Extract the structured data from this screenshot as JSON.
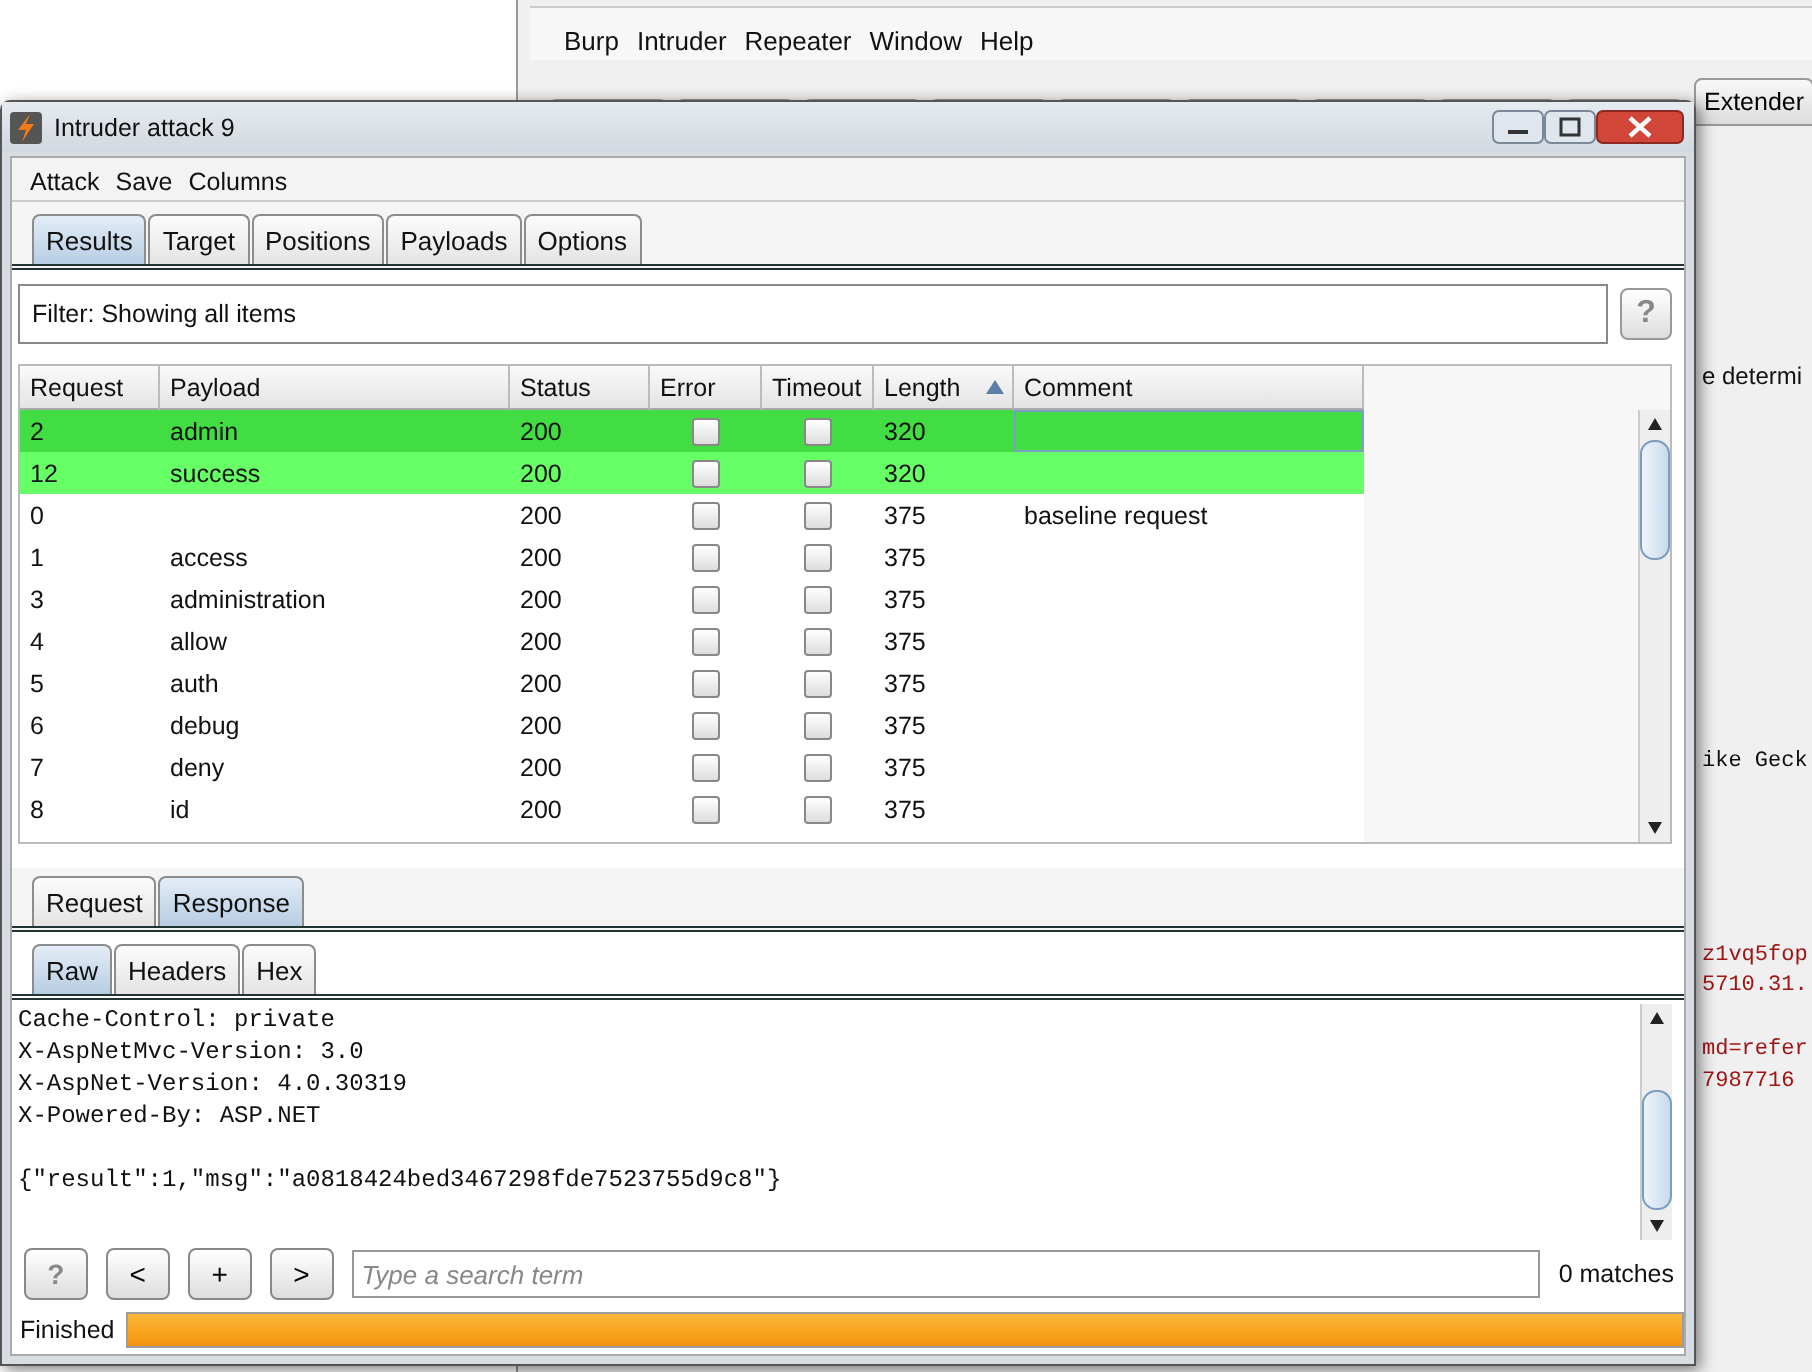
{
  "main_window": {
    "menu": [
      "Burp",
      "Intruder",
      "Repeater",
      "Window",
      "Help"
    ],
    "tabs": [
      {
        "label": "Extender",
        "selected": false
      }
    ],
    "fragments": [
      {
        "text": "e determi",
        "kind": "sans"
      },
      {
        "text": "ike Geck",
        "kind": "mono"
      },
      {
        "text": "z1vq5fop",
        "kind": "red"
      },
      {
        "text": "5710.31.",
        "kind": "red"
      },
      {
        "text": "md=refer",
        "kind": "red"
      },
      {
        "text": "7987716",
        "kind": "red"
      }
    ]
  },
  "window": {
    "title": "Intruder attack 9"
  },
  "menu": [
    "Attack",
    "Save",
    "Columns"
  ],
  "tabs": [
    {
      "label": "Results",
      "selected": true
    },
    {
      "label": "Target",
      "selected": false
    },
    {
      "label": "Positions",
      "selected": false
    },
    {
      "label": "Payloads",
      "selected": false
    },
    {
      "label": "Options",
      "selected": false
    }
  ],
  "filter": "Filter: Showing all items",
  "help_button": "?",
  "table": {
    "columns": [
      {
        "label": "Request",
        "sorted": false
      },
      {
        "label": "Payload",
        "sorted": false
      },
      {
        "label": "Status",
        "sorted": false
      },
      {
        "label": "Error",
        "sorted": false
      },
      {
        "label": "Timeout",
        "sorted": false
      },
      {
        "label": "Length",
        "sorted": true
      },
      {
        "label": "Comment",
        "sorted": false
      }
    ],
    "rows": [
      {
        "request": "2",
        "payload": "admin",
        "status": "200",
        "error": false,
        "timeout": false,
        "length": "320",
        "comment": "",
        "selected": true,
        "color": "#42dd42"
      },
      {
        "request": "12",
        "payload": "success",
        "status": "200",
        "error": false,
        "timeout": false,
        "length": "320",
        "comment": "",
        "selected": false,
        "color": "#66ff66"
      },
      {
        "request": "0",
        "payload": "",
        "status": "200",
        "error": false,
        "timeout": false,
        "length": "375",
        "comment": "baseline request",
        "selected": false
      },
      {
        "request": "1",
        "payload": "access",
        "status": "200",
        "error": false,
        "timeout": false,
        "length": "375",
        "comment": "",
        "selected": false
      },
      {
        "request": "3",
        "payload": "administration",
        "status": "200",
        "error": false,
        "timeout": false,
        "length": "375",
        "comment": "",
        "selected": false
      },
      {
        "request": "4",
        "payload": "allow",
        "status": "200",
        "error": false,
        "timeout": false,
        "length": "375",
        "comment": "",
        "selected": false
      },
      {
        "request": "5",
        "payload": "auth",
        "status": "200",
        "error": false,
        "timeout": false,
        "length": "375",
        "comment": "",
        "selected": false
      },
      {
        "request": "6",
        "payload": "debug",
        "status": "200",
        "error": false,
        "timeout": false,
        "length": "375",
        "comment": "",
        "selected": false
      },
      {
        "request": "7",
        "payload": "deny",
        "status": "200",
        "error": false,
        "timeout": false,
        "length": "375",
        "comment": "",
        "selected": false
      },
      {
        "request": "8",
        "payload": "id",
        "status": "200",
        "error": false,
        "timeout": false,
        "length": "375",
        "comment": "",
        "selected": false
      }
    ]
  },
  "message_tabs": [
    {
      "label": "Request",
      "selected": false
    },
    {
      "label": "Response",
      "selected": true
    }
  ],
  "view_tabs": [
    {
      "label": "Raw",
      "selected": true
    },
    {
      "label": "Headers",
      "selected": false
    },
    {
      "label": "Hex",
      "selected": false
    }
  ],
  "response": {
    "headers": [
      "Cache-Control: private",
      "X-AspNetMvc-Version: 3.0",
      "X-AspNet-Version: 4.0.30319",
      "X-Powered-By: ASP.NET"
    ],
    "body": "{\"result\":1,\"msg\":\"a0818424bed3467298fde7523755d9c8\"}"
  },
  "search": {
    "buttons": [
      "?",
      "<",
      "+",
      ">"
    ],
    "placeholder": "Type a search term",
    "matches": "0 matches"
  },
  "status": {
    "text": "Finished",
    "level": 1
  }
}
